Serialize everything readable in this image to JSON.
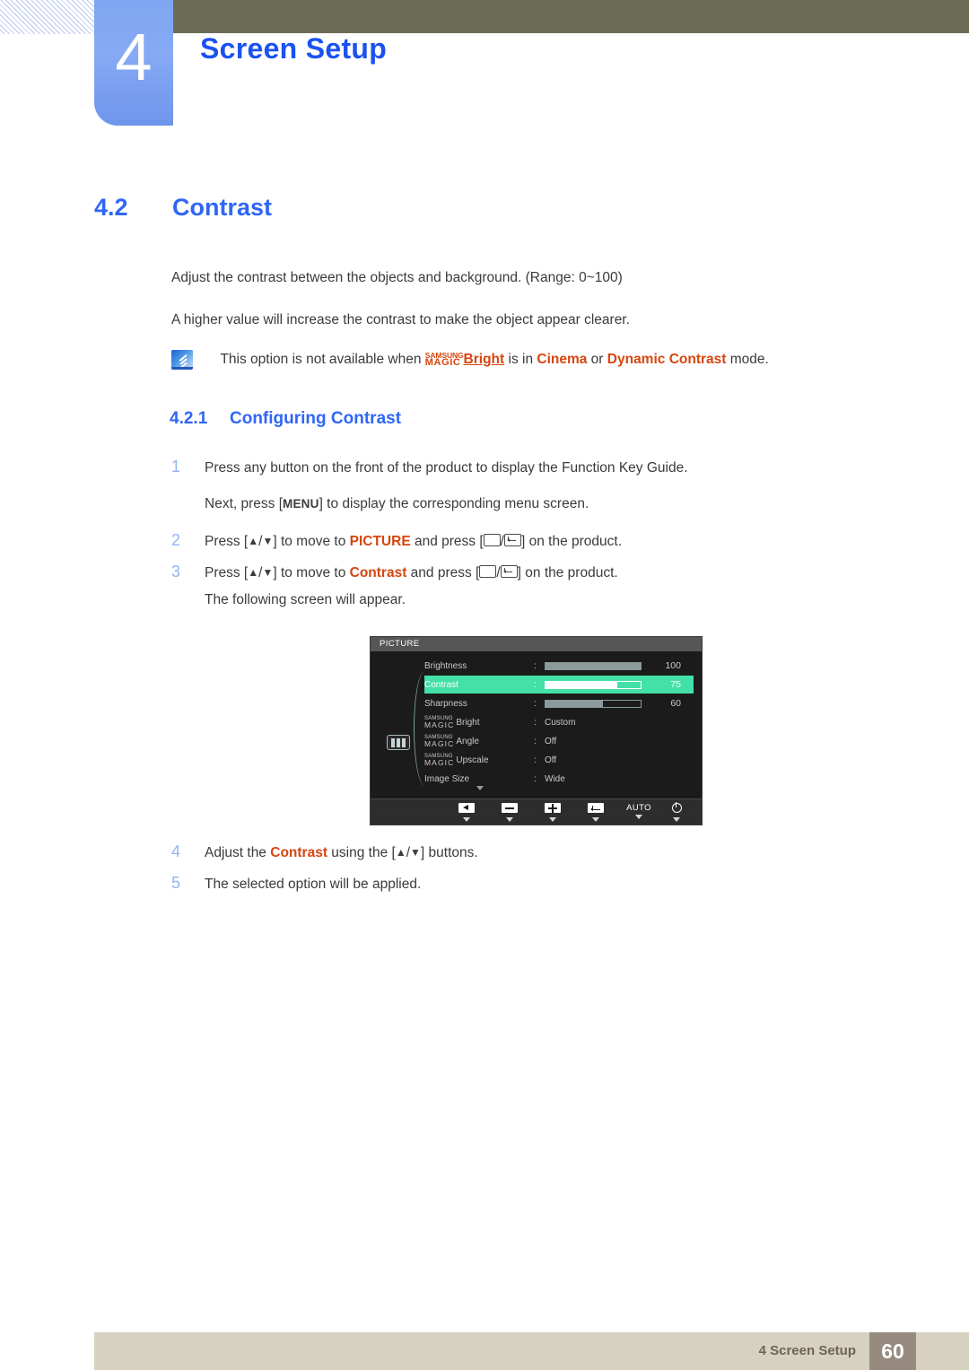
{
  "header": {
    "chapter_number": "4",
    "chapter_title": "Screen Setup"
  },
  "section": {
    "number": "4.2",
    "title": "Contrast"
  },
  "paragraphs": {
    "p1": "Adjust the contrast between the objects and background. (Range: 0~100)",
    "p2": "A higher value will increase the contrast to make the object appear clearer."
  },
  "note": {
    "icon": "note-pen-icon",
    "text_before": "This option is not available when ",
    "magic_top": "SAMSUNG",
    "magic_bottom": "MAGIC",
    "magic_word": "Bright",
    "text_mid1": " is in ",
    "mode_1": "Cinema",
    "text_mid2": " or ",
    "mode_2": "Dynamic Contrast",
    "text_end": " mode."
  },
  "subsection": {
    "number": "4.2.1",
    "title": "Configuring Contrast"
  },
  "steps": {
    "s1_num": "1",
    "s1_text": "Press any button on the front of the product to display the Function Key Guide.",
    "s1b_before": "Next, press [",
    "s1b_key": "MENU",
    "s1b_after": "] to display the corresponding menu screen.",
    "s2_num": "2",
    "s2_a": "Press [",
    "s2_b": "] to move to ",
    "s2_target": "PICTURE",
    "s2_c": " and press [",
    "s2_d": "] on the product.",
    "s3_num": "3",
    "s3_a": "Press [",
    "s3_b": "] to move to ",
    "s3_target": "Contrast",
    "s3_c": " and press [",
    "s3_d": "] on the product.",
    "s3b_text": "The following screen will appear.",
    "s4_num": "4",
    "s4_a": "Adjust the ",
    "s4_target": "Contrast",
    "s4_b": " using the [",
    "s4_c": "] buttons.",
    "s5_num": "5",
    "s5_text": "The selected option will be applied."
  },
  "osd": {
    "title": "PICTURE",
    "left_icon": "picture-mode-icon",
    "rows": [
      {
        "label": "Brightness",
        "colon": ":",
        "value": "100",
        "type": "slider",
        "percent": 100
      },
      {
        "label": "Contrast",
        "colon": ":",
        "value": "75",
        "type": "slider",
        "percent": 75,
        "selected": true
      },
      {
        "label": "Sharpness",
        "colon": ":",
        "value": "60",
        "type": "slider",
        "percent": 60
      },
      {
        "magic_top": "SAMSUNG",
        "magic_bottom": "MAGIC",
        "label": "Bright",
        "colon": ":",
        "value": "Custom",
        "type": "text"
      },
      {
        "magic_top": "SAMSUNG",
        "magic_bottom": "MAGIC",
        "label": "Angle",
        "colon": ":",
        "value": "Off",
        "type": "text"
      },
      {
        "magic_top": "SAMSUNG",
        "magic_bottom": "MAGIC",
        "label": "Upscale",
        "colon": ":",
        "value": "Off",
        "type": "text"
      },
      {
        "label": "Image Size",
        "colon": ":",
        "value": "Wide",
        "type": "text"
      }
    ],
    "footer_buttons": [
      {
        "name": "back-button",
        "glyph": "left-arrow-key"
      },
      {
        "name": "minus-button",
        "glyph": "minus-key"
      },
      {
        "name": "plus-button",
        "glyph": "plus-key"
      },
      {
        "name": "enter-button",
        "glyph": "enter-key"
      },
      {
        "name": "auto-button",
        "glyph": "text",
        "label": "AUTO"
      },
      {
        "name": "power-button",
        "glyph": "power-icon"
      }
    ]
  },
  "footer": {
    "label": "4 Screen Setup",
    "page_number": "60"
  },
  "colors": {
    "accent_blue": "#2f66f7",
    "highlight_orange": "#d6450e",
    "olive": "#6d6c57",
    "footer_beige": "#d7d2c0",
    "page_box_brown": "#968b7e",
    "osd_selected_green": "#43e0a8"
  }
}
